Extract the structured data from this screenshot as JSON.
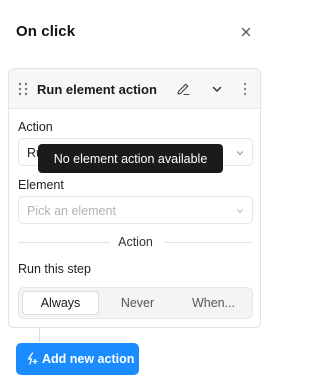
{
  "panel": {
    "title": "On click"
  },
  "card": {
    "title": "Run element action",
    "action_label": "Action",
    "action_value": "Ru",
    "tooltip": "No element action available",
    "element_label": "Element",
    "element_placeholder": "Pick an element",
    "section_divider": "Action",
    "run_step_label": "Run this step",
    "run_step_options": [
      "Always",
      "Never",
      "When..."
    ],
    "run_step_selected": "Always"
  },
  "add_button": {
    "label": "Add new action"
  },
  "colors": {
    "accent": "#1a8cff",
    "tooltip_bg": "#1b1b1b"
  },
  "icons": [
    "close-icon",
    "drag-handle-icon",
    "edit-icon",
    "chevron-down-icon",
    "more-vertical-icon",
    "add-action-icon"
  ]
}
